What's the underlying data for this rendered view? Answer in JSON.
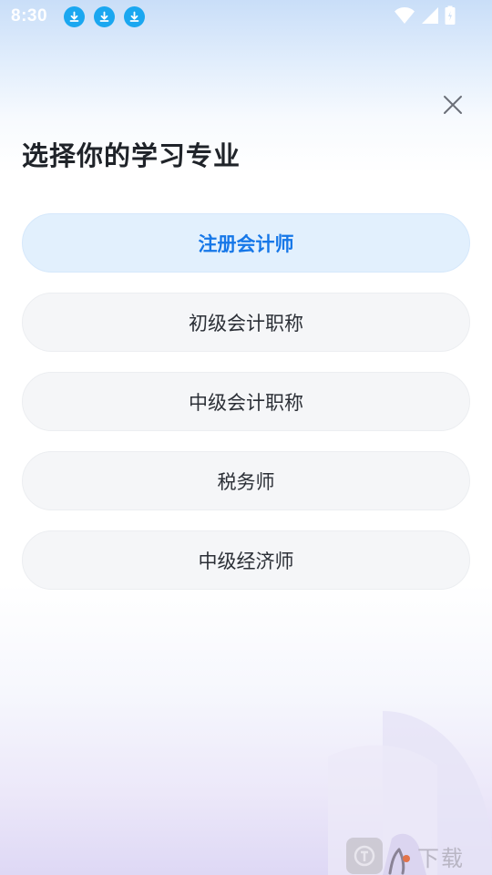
{
  "status_bar": {
    "time": "8:30",
    "download_icons": [
      "download-icon",
      "download-icon",
      "download-icon"
    ],
    "right_icons": [
      "wifi-icon",
      "signal-icon",
      "battery-icon"
    ]
  },
  "dialog": {
    "close_icon": "close-icon",
    "title": "选择你的学习专业"
  },
  "options": [
    {
      "label": "注册会计师",
      "selected": true
    },
    {
      "label": "初级会计职称",
      "selected": false
    },
    {
      "label": "中级会计职称",
      "selected": false
    },
    {
      "label": "税务师",
      "selected": false
    },
    {
      "label": "中级经济师",
      "selected": false
    }
  ],
  "watermark": {
    "text": "下载"
  },
  "colors": {
    "accent": "#1677e8",
    "selected_bg": "#e2f0fd",
    "option_bg": "#f5f6f8",
    "title": "#1f2329"
  }
}
